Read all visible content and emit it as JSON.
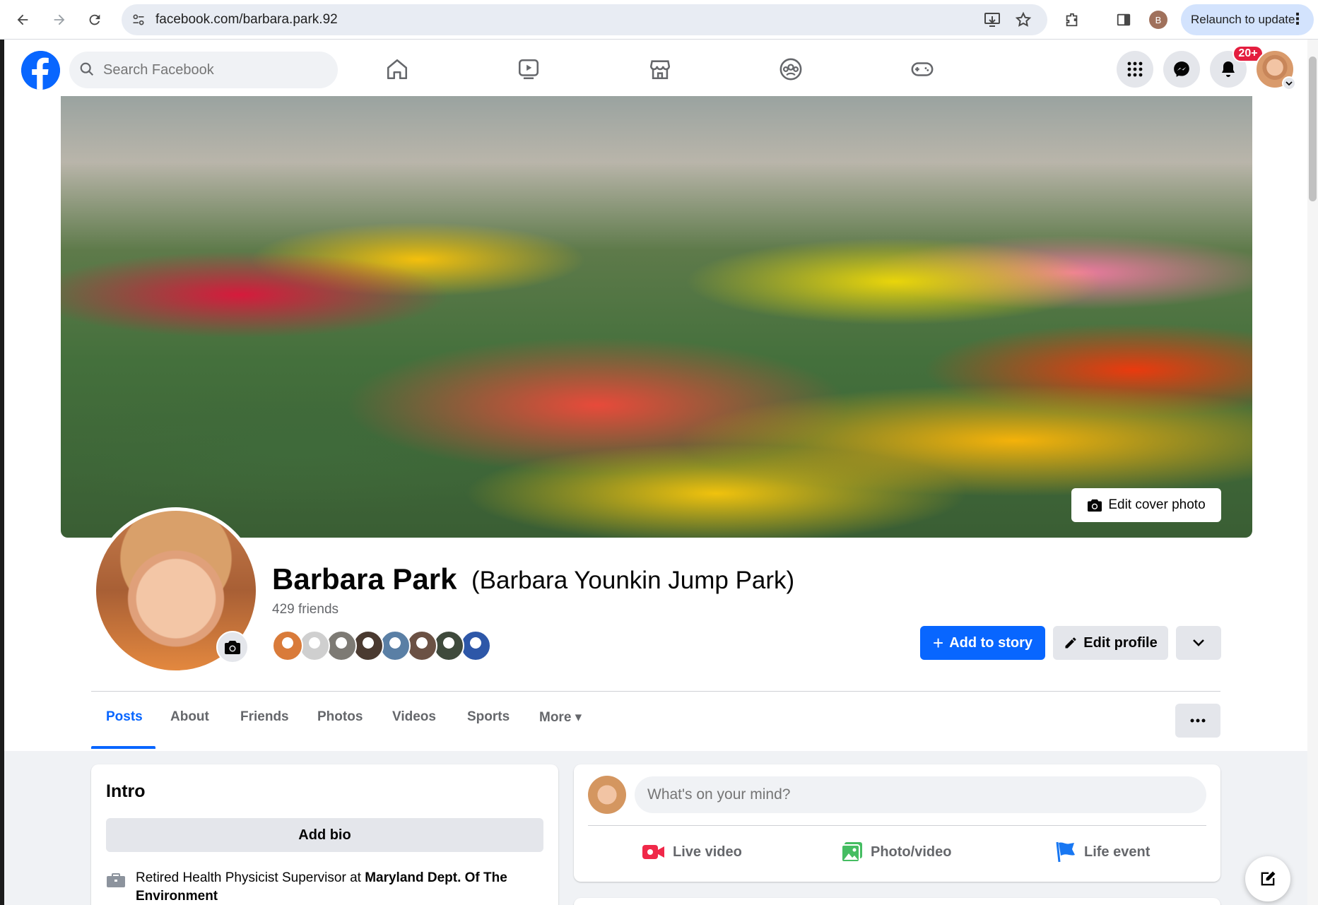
{
  "browser": {
    "url": "facebook.com/barbara.park.92",
    "relaunch_label": "Relaunch to update",
    "profile_initial": "B"
  },
  "header": {
    "search_placeholder": "Search Facebook",
    "notification_badge": "20+",
    "nav_icons": [
      "home-icon",
      "video-icon",
      "marketplace-icon",
      "groups-icon",
      "gaming-icon"
    ]
  },
  "cover": {
    "edit_label": "Edit cover photo"
  },
  "profile": {
    "name": "Barbara Park",
    "alternate_name": "(Barbara Younkin Jump Park)",
    "friends_count": "429 friends",
    "add_story_label": "Add to story",
    "edit_profile_label": "Edit profile",
    "friend_avatar_colors": [
      "#d97b3a",
      "#cfcfcf",
      "#7d7a74",
      "#4a3a30",
      "#5a7fa5",
      "#6b5144",
      "#3f4a3c",
      "#2d57a8"
    ]
  },
  "tabs": [
    {
      "label": "Posts",
      "active": true
    },
    {
      "label": "About"
    },
    {
      "label": "Friends"
    },
    {
      "label": "Photos"
    },
    {
      "label": "Videos"
    },
    {
      "label": "Sports"
    },
    {
      "label": "More"
    }
  ],
  "intro": {
    "title": "Intro",
    "add_bio_label": "Add bio",
    "work_prefix": "Retired Health Physicist Supervisor at ",
    "work_org": "Maryland Dept. Of The Environment"
  },
  "composer": {
    "placeholder": "What's on your mind?",
    "actions": [
      {
        "label": "Live video",
        "color": "#f02849"
      },
      {
        "label": "Photo/video",
        "color": "#45bd62"
      },
      {
        "label": "Life event",
        "color": "#1877f2"
      }
    ]
  },
  "colors": {
    "brand": "#0866ff",
    "text_secondary": "#65676b"
  }
}
